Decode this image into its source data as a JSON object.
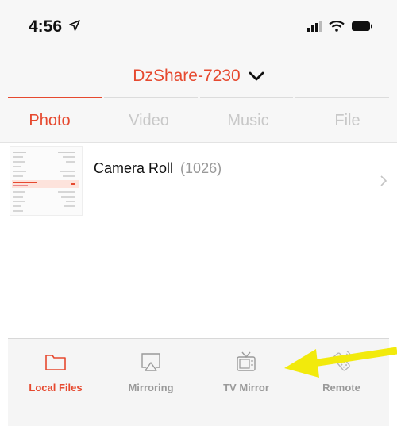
{
  "status_bar": {
    "time": "4:56"
  },
  "nav": {
    "title": "DzShare-7230"
  },
  "tabs": [
    {
      "label": "Photo",
      "active": true
    },
    {
      "label": "Video",
      "active": false
    },
    {
      "label": "Music",
      "active": false
    },
    {
      "label": "File",
      "active": false
    }
  ],
  "albums": [
    {
      "name": "Camera Roll",
      "count": "(1026)"
    }
  ],
  "bottom_tabs": [
    {
      "label": "Local Files",
      "icon": "folder-icon",
      "active": true
    },
    {
      "label": "Mirroring",
      "icon": "airplay-icon",
      "active": false
    },
    {
      "label": "TV Mirror",
      "icon": "tv-icon",
      "active": false
    },
    {
      "label": "Remote",
      "icon": "remote-icon",
      "active": false
    }
  ],
  "colors": {
    "accent": "#e6492f",
    "annotation_arrow": "#f2ea0c",
    "inactive": "#9a9a9a"
  }
}
